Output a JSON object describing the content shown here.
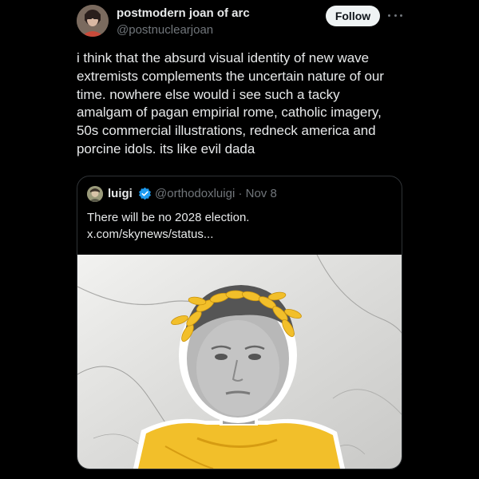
{
  "author": {
    "display_name": "postmodern joan of arc",
    "handle": "@postnuclearjoan",
    "avatar_icon": "profile-photo"
  },
  "actions": {
    "follow_label": "Follow",
    "more_icon": "more-dots-icon"
  },
  "tweet": {
    "text": "i think that the absurd visual identity of new wave\nextremists complements the uncertain nature of our\ntime. nowhere else would i see such a tacky\namalgam of pagan empirial rome, catholic imagery,\n50s commercial illustrations, redneck america and\nporcine idols. its like evil dada"
  },
  "quote": {
    "author_name": "luigi",
    "verified": true,
    "verified_color": "#1d9bf0",
    "handle_date": "@orthodoxluigi · Nov 8",
    "text": "There will be no 2028 election.\nx.com/skynews/status...",
    "image_icon": "collage-photo",
    "accent_yellow": "#f2bf2a"
  },
  "colors": {
    "background": "#000000",
    "text_primary": "#e7e9ea",
    "text_secondary": "#71767b",
    "button_bg": "#eff3f4",
    "card_border": "#2f3336"
  }
}
